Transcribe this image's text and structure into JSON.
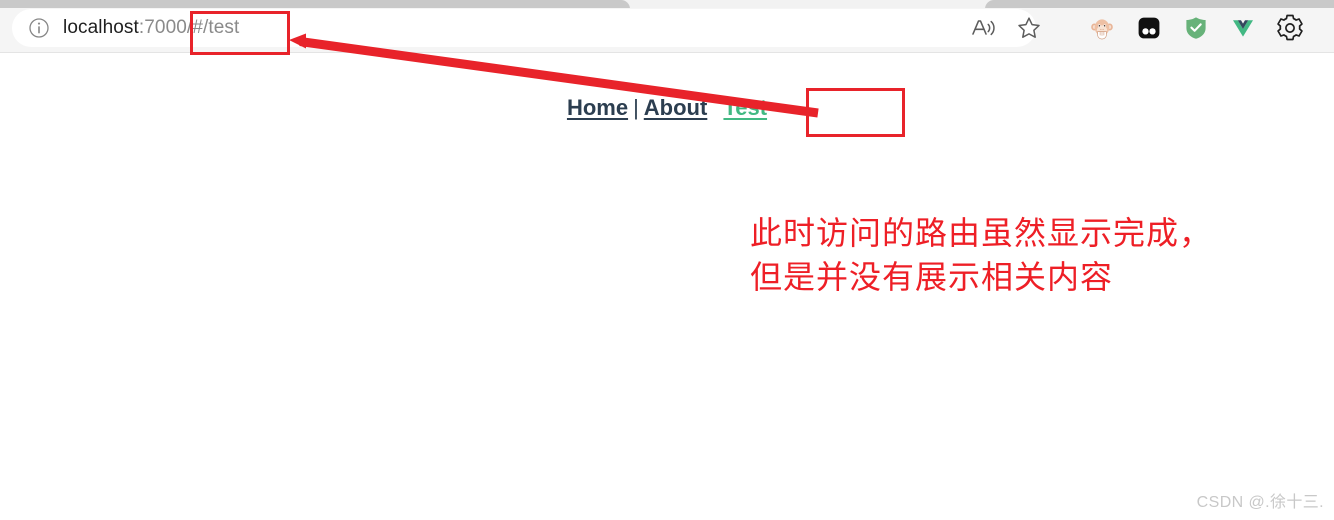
{
  "browser": {
    "address_bar": {
      "info_icon": "info-circle-icon",
      "url_host": "localhost",
      "url_rest": ":7000/#/test",
      "url_full": "localhost:7000/#/test"
    },
    "toolbar_buttons": [
      {
        "name": "read-aloud-icon",
        "label": "Read aloud"
      },
      {
        "name": "favorite-star-icon",
        "label": "Add this page to favorites"
      }
    ],
    "extensions": [
      {
        "name": "monkey-avatar-extension-icon",
        "label": "Monkey extension"
      },
      {
        "name": "dark-reader-extension-icon",
        "label": "Dark Reader"
      },
      {
        "name": "adguard-shield-extension-icon",
        "label": "AdGuard"
      },
      {
        "name": "vuejs-devtools-extension-icon",
        "label": "Vue.js devtools"
      },
      {
        "name": "settings-gear-icon",
        "label": "Settings and more"
      }
    ]
  },
  "page": {
    "nav": {
      "items": [
        {
          "label": "Home",
          "active": false
        },
        {
          "label": "About",
          "active": false
        },
        {
          "label": "Test",
          "active": true
        }
      ],
      "separator": "|"
    },
    "annotation_note": "此时访问的路由虽然显示完成，\n但是并没有展示相关内容",
    "watermark": "CSDN @.徐十三."
  },
  "colors": {
    "annotation_red": "#e8232a",
    "note_red": "#ee1f26",
    "active_link_green": "#42b983",
    "nav_link_dark": "#2c3e50",
    "chrome_background": "#f5f5f5",
    "address_bar_background": "#ffffff"
  }
}
